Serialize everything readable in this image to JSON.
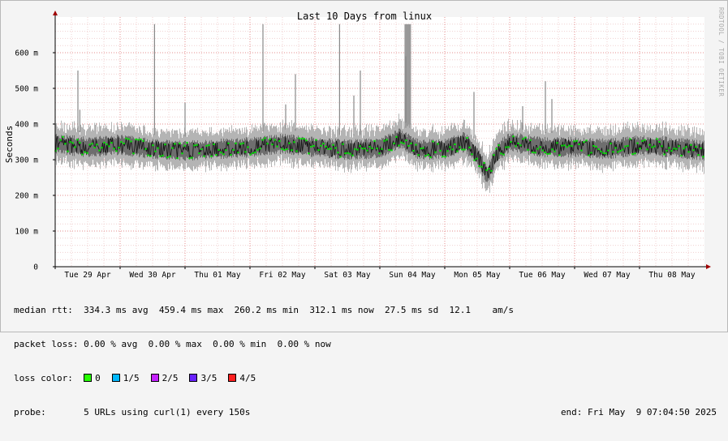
{
  "chart_data": {
    "type": "area",
    "title": "Last 10 Days from linux",
    "ylabel": "Seconds",
    "xlabel": "",
    "ylim": [
      0,
      0.7
    ],
    "xlim": [
      0,
      10
    ],
    "yticks": [
      {
        "value": 0,
        "label": "0"
      },
      {
        "value": 0.1,
        "label": "100 m"
      },
      {
        "value": 0.2,
        "label": "200 m"
      },
      {
        "value": 0.3,
        "label": "300 m"
      },
      {
        "value": 0.4,
        "label": "400 m"
      },
      {
        "value": 0.5,
        "label": "500 m"
      },
      {
        "value": 0.6,
        "label": "600 m"
      }
    ],
    "xticks": [
      "Tue 29 Apr",
      "Wed 30 Apr",
      "Thu 01 May",
      "Fri 02 May",
      "Sat 03 May",
      "Sun 04 May",
      "Mon 05 May",
      "Tue 06 May",
      "Wed 07 May",
      "Thu 08 May"
    ],
    "grid": true,
    "watermark": "RRDTOOL / TOBI OETIKER",
    "series": [
      {
        "name": "median rtt",
        "color": "#00e000"
      }
    ],
    "median_profile": [
      {
        "day": 0.0,
        "value": 0.345
      },
      {
        "day": 0.5,
        "value": 0.335
      },
      {
        "day": 1.0,
        "value": 0.342
      },
      {
        "day": 1.5,
        "value": 0.33
      },
      {
        "day": 2.0,
        "value": 0.325
      },
      {
        "day": 2.5,
        "value": 0.33
      },
      {
        "day": 3.0,
        "value": 0.335
      },
      {
        "day": 3.5,
        "value": 0.345
      },
      {
        "day": 4.0,
        "value": 0.335
      },
      {
        "day": 4.5,
        "value": 0.328
      },
      {
        "day": 5.0,
        "value": 0.332
      },
      {
        "day": 5.3,
        "value": 0.36
      },
      {
        "day": 5.6,
        "value": 0.328
      },
      {
        "day": 6.0,
        "value": 0.33
      },
      {
        "day": 6.3,
        "value": 0.35
      },
      {
        "day": 6.5,
        "value": 0.31
      },
      {
        "day": 6.65,
        "value": 0.255
      },
      {
        "day": 6.8,
        "value": 0.32
      },
      {
        "day": 7.0,
        "value": 0.35
      },
      {
        "day": 7.5,
        "value": 0.335
      },
      {
        "day": 8.0,
        "value": 0.335
      },
      {
        "day": 8.5,
        "value": 0.33
      },
      {
        "day": 9.0,
        "value": 0.34
      },
      {
        "day": 9.5,
        "value": 0.335
      },
      {
        "day": 10.0,
        "value": 0.325
      }
    ],
    "spikes": [
      {
        "day": 0.35,
        "value": 0.55
      },
      {
        "day": 0.38,
        "value": 0.44
      },
      {
        "day": 1.53,
        "value": 0.68
      },
      {
        "day": 2.0,
        "value": 0.46
      },
      {
        "day": 3.2,
        "value": 0.68
      },
      {
        "day": 3.55,
        "value": 0.455
      },
      {
        "day": 3.7,
        "value": 0.54
      },
      {
        "day": 4.38,
        "value": 0.68
      },
      {
        "day": 4.6,
        "value": 0.48
      },
      {
        "day": 4.7,
        "value": 0.55
      },
      {
        "day": 5.4,
        "value": 0.59
      },
      {
        "day": 6.45,
        "value": 0.49
      },
      {
        "day": 7.2,
        "value": 0.45
      },
      {
        "day": 7.55,
        "value": 0.52
      },
      {
        "day": 7.65,
        "value": 0.47
      }
    ],
    "loss_band": {
      "from_day": 5.38,
      "to_day": 5.48,
      "value": 0.68
    }
  },
  "stats": {
    "median_rtt": {
      "label": "median rtt:",
      "avg": "334.3 ms avg",
      "max": "459.4 ms max",
      "min": "260.2 ms min",
      "now": "312.1 ms now",
      "sd": "27.5 ms sd",
      "ams": "12.1",
      "ams_unit": "am/s"
    },
    "packet_loss": {
      "label": "packet loss:",
      "avg": "0.00 % avg",
      "max": "0.00 % max",
      "min": "0.00 % min",
      "now": "0.00 % now"
    },
    "loss_color": {
      "label": "loss color:",
      "items": [
        {
          "label": "0",
          "color": "#26ff00"
        },
        {
          "label": "1/5",
          "color": "#00b8ff"
        },
        {
          "label": "2/5",
          "color": "#c421ff"
        },
        {
          "label": "3/5",
          "color": "#6921ff"
        },
        {
          "label": "4/5",
          "color": "#ff1f1f"
        }
      ]
    },
    "probe": {
      "label": "probe:",
      "text": "5 URLs using curl(1) every 150s"
    },
    "end": "end: Fri May  9 07:04:50 2025"
  }
}
